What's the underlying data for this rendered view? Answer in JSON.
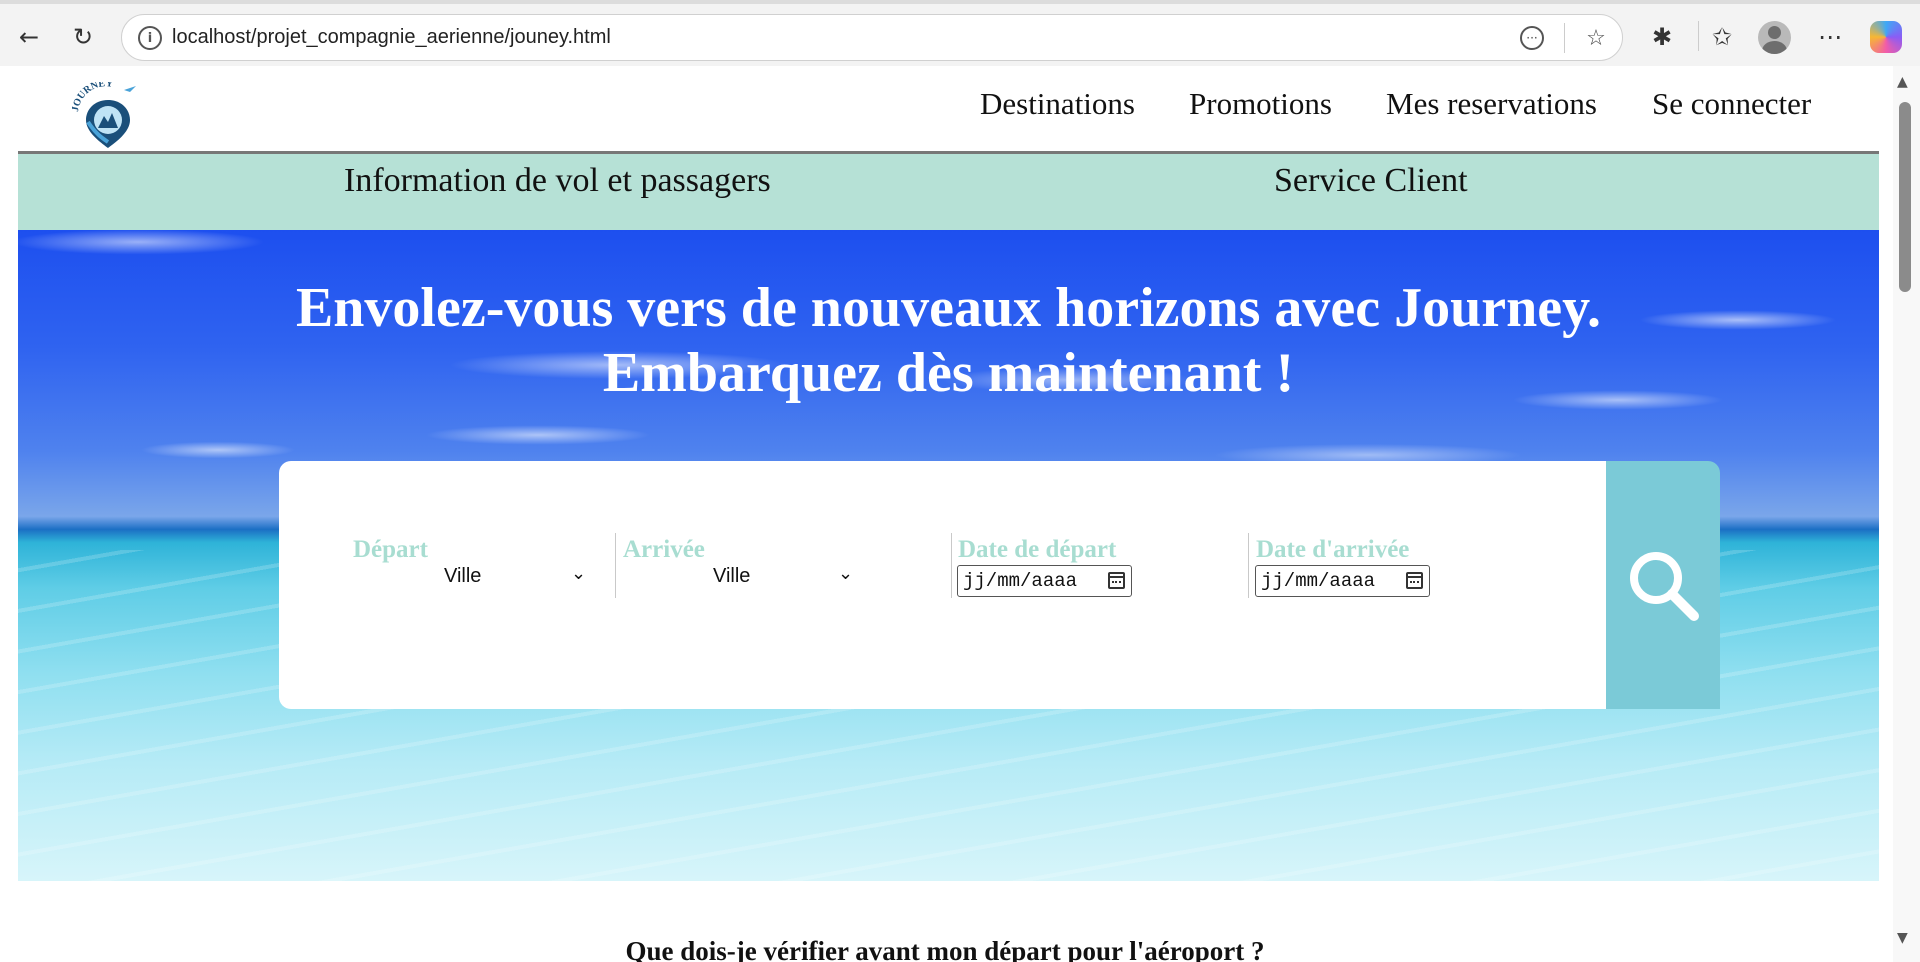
{
  "browser": {
    "url": "localhost/projet_compagnie_aerienne/jouney.html",
    "back_icon": "back-arrow-icon",
    "reload_icon": "reload-icon",
    "info_icon": "info-icon"
  },
  "header": {
    "logo_text": "JOURNEY",
    "nav": [
      {
        "label": "Destinations"
      },
      {
        "label": "Promotions"
      },
      {
        "label": "Mes reservations"
      },
      {
        "label": "Se connecter"
      }
    ]
  },
  "subnav": {
    "items": [
      {
        "label": "Information de vol et passagers"
      },
      {
        "label": "Service Client"
      }
    ],
    "background": "#b6e1d6"
  },
  "hero": {
    "title_line1": "Envolez-vous vers de nouveaux horizons avec Journey.",
    "title_line2": "Embarquez dès maintenant !"
  },
  "search": {
    "depart_label": "Départ",
    "depart_value": "Ville",
    "arrivee_label": "Arrivée",
    "arrivee_value": "Ville",
    "date_depart_label": "Date de départ",
    "date_depart_placeholder": "jj/mm/aaaa",
    "date_arrivee_label": "Date d'arrivée",
    "date_arrivee_placeholder": "jj/mm/aaaa",
    "label_color": "#a8ddd1",
    "button_color": "#7bcad7"
  },
  "content": {
    "question": "Que dois-je vérifier avant mon départ pour l'aéroport ?"
  }
}
